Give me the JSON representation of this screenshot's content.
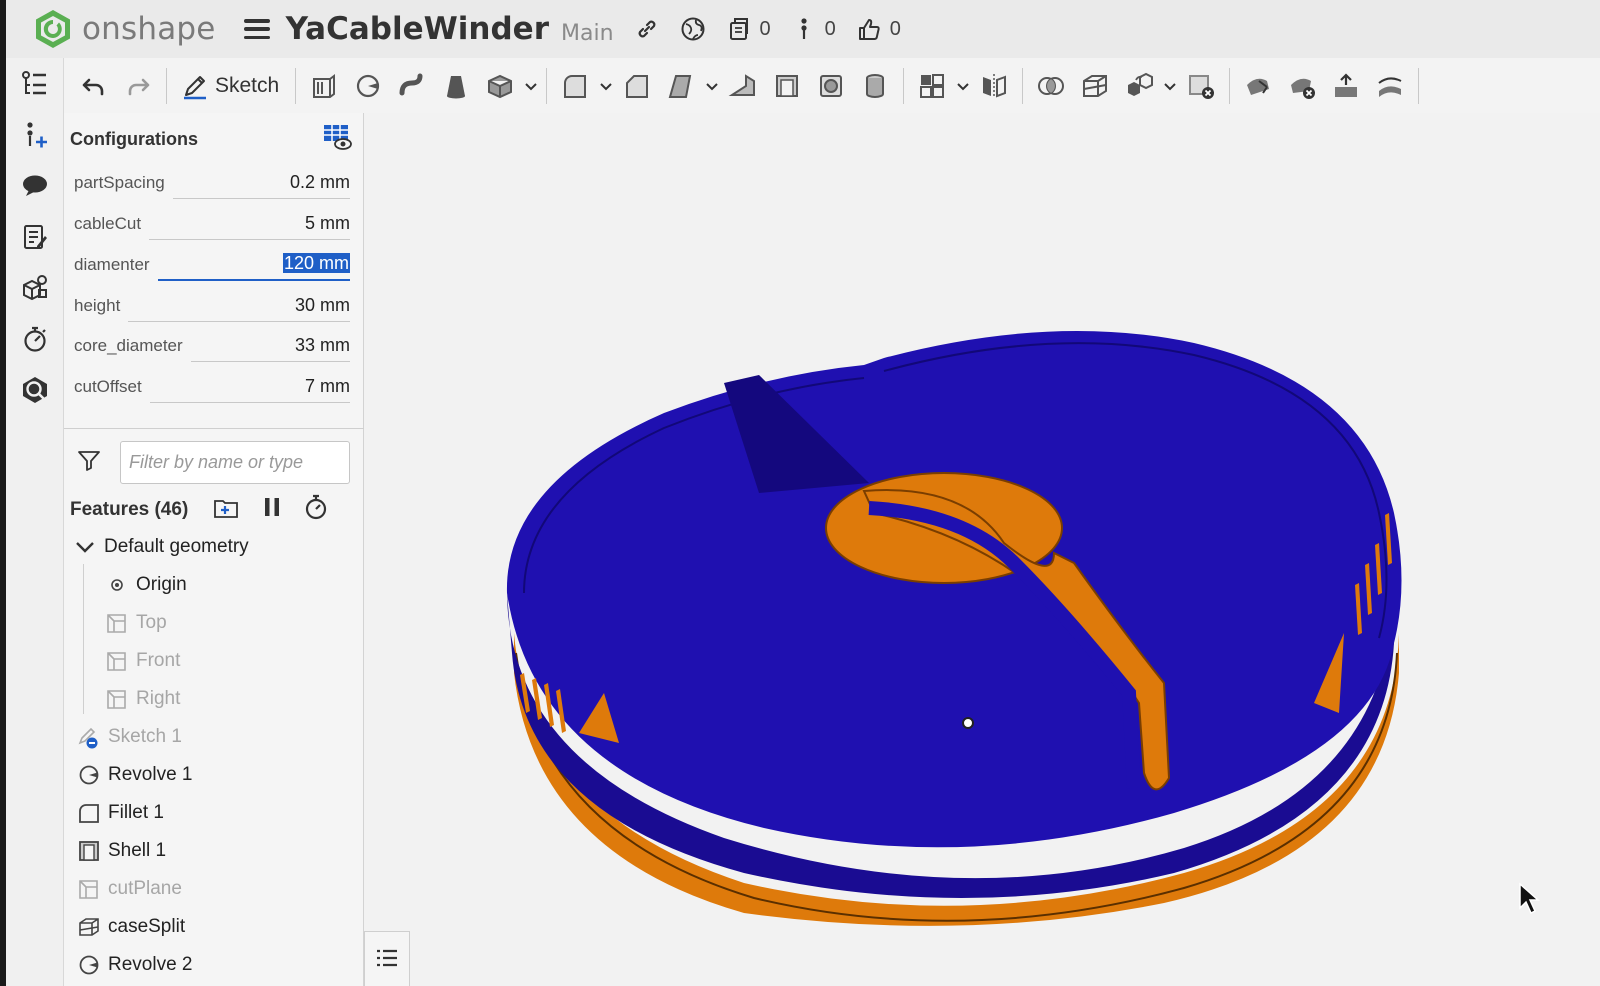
{
  "header": {
    "logo_text": "onshape",
    "doc_title": "YaCableWinder",
    "branch": "Main",
    "versions_count": "0",
    "branches_count": "0",
    "likes_count": "0"
  },
  "toolbar": {
    "sketch_label": "Sketch"
  },
  "configurations": {
    "title": "Configurations",
    "rows": [
      {
        "label": "partSpacing",
        "value": "0.2 mm"
      },
      {
        "label": "cableCut",
        "value": "5 mm"
      },
      {
        "label": "diamenter",
        "value": "120 mm"
      },
      {
        "label": "height",
        "value": "30 mm"
      },
      {
        "label": "core_diameter",
        "value": "33 mm"
      },
      {
        "label": "cutOffset",
        "value": "7 mm"
      }
    ]
  },
  "filter": {
    "placeholder": "Filter by name or type"
  },
  "features": {
    "title": "Features (46)",
    "default_geometry": "Default geometry",
    "items": [
      {
        "label": "Origin"
      },
      {
        "label": "Top"
      },
      {
        "label": "Front"
      },
      {
        "label": "Right"
      },
      {
        "label": "Sketch 1"
      },
      {
        "label": "Revolve 1"
      },
      {
        "label": "Fillet 1"
      },
      {
        "label": "Shell 1"
      },
      {
        "label": "cutPlane"
      },
      {
        "label": "caseSplit"
      },
      {
        "label": "Revolve 2"
      }
    ]
  },
  "colors": {
    "part_blue": "#1c0ea6",
    "part_orange": "#de7a0b",
    "selection_blue": "#1f5fc7",
    "logo_green": "#4caf50"
  }
}
